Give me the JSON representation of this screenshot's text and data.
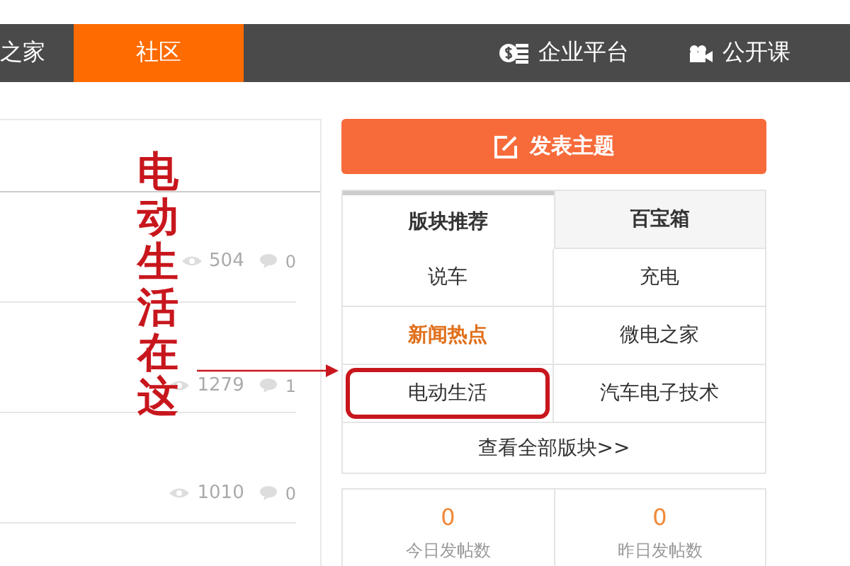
{
  "nav": {
    "items": [
      {
        "label": "之家",
        "selected": false
      },
      {
        "label": "社区",
        "selected": true
      }
    ],
    "right_items": [
      {
        "label": "企业平台"
      },
      {
        "label": "公开课"
      }
    ]
  },
  "threads": [
    {
      "views": "504",
      "replies": "0"
    },
    {
      "views": "1279",
      "replies": "1"
    },
    {
      "views": "1010",
      "replies": "0"
    }
  ],
  "post_button": {
    "label": "发表主题"
  },
  "forum_tabs": [
    {
      "label": "版块推荐",
      "selected": true
    },
    {
      "label": "百宝箱",
      "selected": false
    }
  ],
  "forums": [
    {
      "label": "说车",
      "hot": false,
      "highlighted": false
    },
    {
      "label": "充电",
      "hot": false,
      "highlighted": false
    },
    {
      "label": "新闻热点",
      "hot": true,
      "highlighted": false
    },
    {
      "label": "微电之家",
      "hot": false,
      "highlighted": false
    },
    {
      "label": "电动生活",
      "hot": false,
      "highlighted": true
    },
    {
      "label": "汽车电子技术",
      "hot": false,
      "highlighted": false
    }
  ],
  "view_all": "查看全部版块>>",
  "stats": [
    {
      "value": "0",
      "label": "今日发帖数"
    },
    {
      "value": "0",
      "label": "昨日发帖数"
    }
  ],
  "annotation": {
    "text": "电动生活在这"
  }
}
